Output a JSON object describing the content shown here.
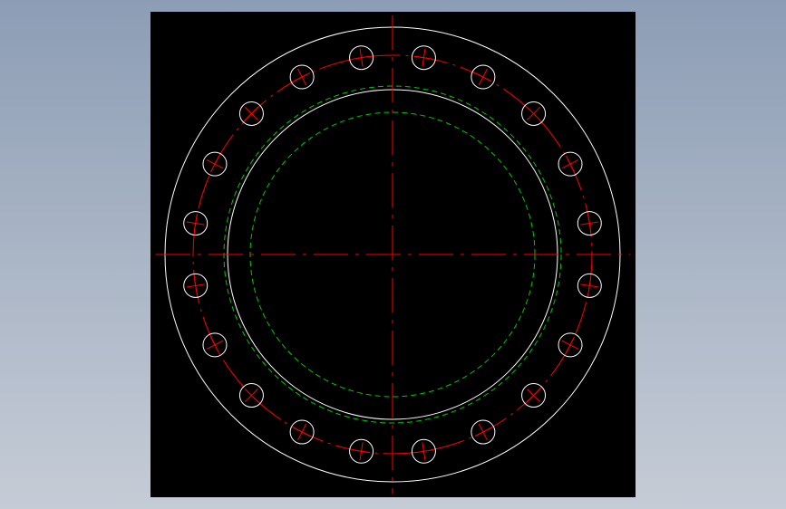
{
  "drawing": {
    "kind": "flange plan view",
    "background_color": "#000000",
    "layers": {
      "outline": {
        "color": "#ffffff",
        "linetype": "continuous"
      },
      "centerline": {
        "color": "#ff0000",
        "linetype": "dash-dot"
      },
      "hidden": {
        "color": "#00c800",
        "linetype": "dashed"
      }
    },
    "bolt_hole_count": 20
  }
}
